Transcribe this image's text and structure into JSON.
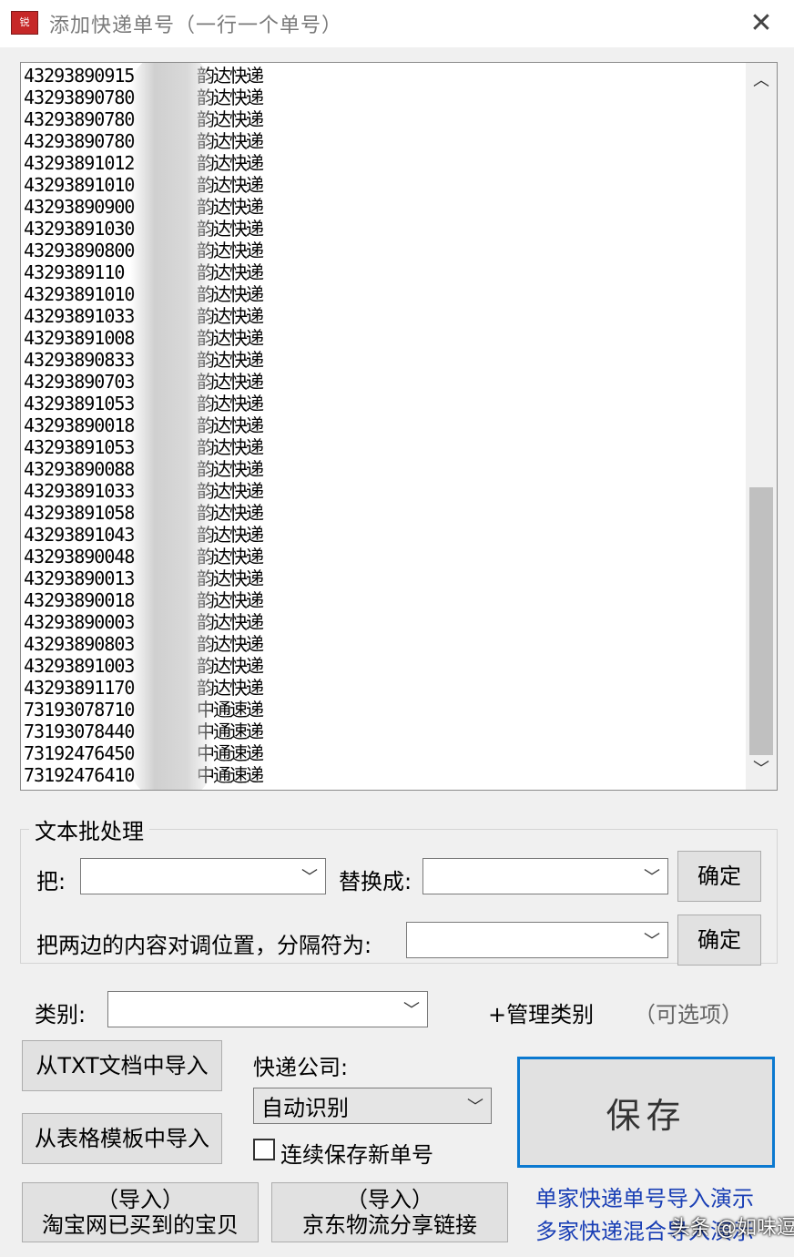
{
  "window": {
    "icon_text": "锐",
    "title": "添加快递单号（一行一个单号）",
    "close_glyph": "✕"
  },
  "list": {
    "rows": [
      {
        "num": "43293890915",
        "company": "韵达快递"
      },
      {
        "num": "43293890780",
        "company": "韵达快递"
      },
      {
        "num": "43293890780",
        "company": "韵达快递"
      },
      {
        "num": "43293890780",
        "company": "韵达快递"
      },
      {
        "num": "43293891012",
        "company": "韵达快递"
      },
      {
        "num": "43293891010",
        "company": "韵达快递"
      },
      {
        "num": "43293890900",
        "company": "韵达快递"
      },
      {
        "num": "43293891030",
        "company": "韵达快递"
      },
      {
        "num": "43293890800",
        "company": "韵达快递"
      },
      {
        "num": "4329389110",
        "company": "韵达快递"
      },
      {
        "num": "43293891010",
        "company": "韵达快递"
      },
      {
        "num": "43293891033",
        "company": "韵达快递"
      },
      {
        "num": "43293891008",
        "company": "韵达快递"
      },
      {
        "num": "43293890833",
        "company": "韵达快递"
      },
      {
        "num": "43293890703",
        "company": "韵达快递"
      },
      {
        "num": "43293891053",
        "company": "韵达快递"
      },
      {
        "num": "43293890018",
        "company": "韵达快递"
      },
      {
        "num": "43293891053",
        "company": "韵达快递"
      },
      {
        "num": "43293890088",
        "company": "韵达快递"
      },
      {
        "num": "43293891033",
        "company": "韵达快递"
      },
      {
        "num": "43293891058",
        "company": "韵达快递"
      },
      {
        "num": "43293891043",
        "company": "韵达快递"
      },
      {
        "num": "43293890048",
        "company": "韵达快递"
      },
      {
        "num": "43293890013",
        "company": "韵达快递"
      },
      {
        "num": "43293890018",
        "company": "韵达快递"
      },
      {
        "num": "43293890003",
        "company": "韵达快递"
      },
      {
        "num": "43293890803",
        "company": "韵达快递"
      },
      {
        "num": "43293891003",
        "company": "韵达快递"
      },
      {
        "num": "43293891170",
        "company": "韵达快递"
      },
      {
        "num": "73193078710",
        "company": "中通速递"
      },
      {
        "num": "73193078440",
        "company": "中通速递"
      },
      {
        "num": "73192476450",
        "company": "中通速递"
      },
      {
        "num": "73192476410",
        "company": "中通速递"
      }
    ],
    "scroll_up": "︿",
    "scroll_down": "﹀",
    "scroll_position": 0.58
  },
  "batch": {
    "group_label": "文本批处理",
    "replace_from_label": "把:",
    "replace_to_label": "替换成:",
    "confirm_1": "确定",
    "swap_label": "把两边的内容对调位置，分隔符为:",
    "confirm_2": "确定",
    "dropdown_arrow": "﹀"
  },
  "category": {
    "label": "类别:",
    "manage": "+管理类别",
    "optional": "（可选项）"
  },
  "import": {
    "txt": "从TXT文档中导入",
    "template": "从表格模板中导入",
    "taobao_line1": "（导入）",
    "taobao_line2": "淘宝网已买到的宝贝",
    "jd_line1": "（导入）",
    "jd_line2": "京东物流分享链接"
  },
  "courier": {
    "label": "快递公司:",
    "selected": "自动识别",
    "continuous_save": "连续保存新单号"
  },
  "save_label": "保存",
  "links": {
    "single": "单家快递单号导入演示",
    "multi": "多家快递混合导入演示"
  },
  "watermark": "头条 @如味逗"
}
